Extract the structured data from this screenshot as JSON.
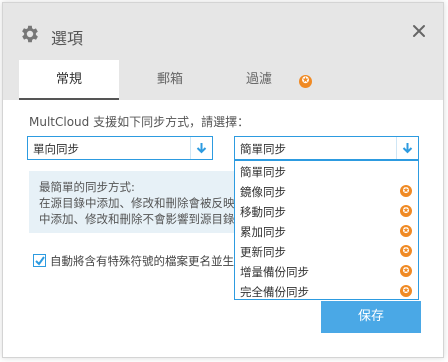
{
  "dialog": {
    "title": "選項",
    "close_label": "×"
  },
  "tabs": [
    {
      "label": "常規",
      "active": true
    },
    {
      "label": "郵箱",
      "active": false
    },
    {
      "label": "過濾",
      "active": false,
      "badge": "✪"
    }
  ],
  "content": {
    "intro": "MultCloud 支援如下同步方式，請選擇："
  },
  "left_select": {
    "value": "單向同步"
  },
  "right_select": {
    "value": "簡單同步"
  },
  "dropdown": {
    "items": [
      {
        "label": "簡單同步",
        "premium": false
      },
      {
        "label": "鏡像同步",
        "premium": true
      },
      {
        "label": "移動同步",
        "premium": true
      },
      {
        "label": "累加同步",
        "premium": true
      },
      {
        "label": "更新同步",
        "premium": true
      },
      {
        "label": "增量備份同步",
        "premium": true
      },
      {
        "label": "完全備份同步",
        "premium": true
      }
    ],
    "star_glyph": "✪"
  },
  "info_box": {
    "lines": [
      "最簡單的同步方式:",
      "在源目錄中添加、修改和刪除會被反映",
      "中添加、修改和刪除不會影響到源目錄"
    ]
  },
  "checkbox": {
    "checked": true,
    "label": "自動將含有特殊符號的檔案更名並生成"
  },
  "footer": {
    "save_label": "保存"
  },
  "colors": {
    "accent": "#2d9be0",
    "button": "#4aa8e6",
    "premium": "#f08a24",
    "header_bg": "#e6e6e6",
    "info_bg": "#e7f1f7"
  }
}
